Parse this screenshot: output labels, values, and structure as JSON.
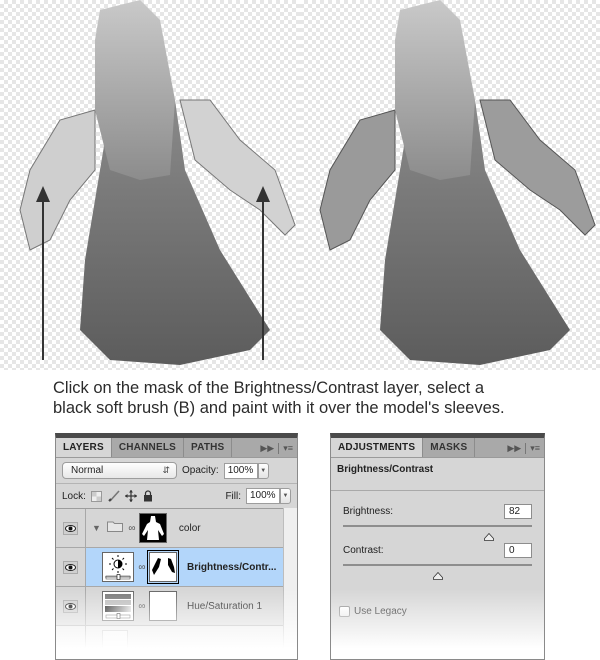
{
  "images": {
    "before": {
      "label": "model-before",
      "arrows": 2
    },
    "after": {
      "label": "model-after"
    }
  },
  "caption": {
    "line1": "Click on the mask of the Brightness/Contrast layer, select a",
    "line2": "black soft brush (B) and paint with it over the model's sleeves."
  },
  "layers_panel": {
    "tabs": [
      "LAYERS",
      "CHANNELS",
      "PATHS"
    ],
    "active_tab": "LAYERS",
    "blend_mode": "Normal",
    "opacity_label": "Opacity:",
    "opacity_value": "100%",
    "lock_label": "Lock:",
    "fill_label": "Fill:",
    "fill_value": "100%",
    "layers": [
      {
        "name": "color",
        "type": "group",
        "expanded": true,
        "visible": true,
        "selected": false
      },
      {
        "name": "Brightness/Contr...",
        "type": "adjustment-brightness-contrast",
        "visible": true,
        "selected": true
      },
      {
        "name": "Hue/Saturation 1",
        "type": "adjustment-hue-saturation",
        "visible": true,
        "selected": false
      }
    ]
  },
  "adjustments_panel": {
    "tabs": [
      "ADJUSTMENTS",
      "MASKS"
    ],
    "active_tab": "ADJUSTMENTS",
    "title": "Brightness/Contrast",
    "brightness_label": "Brightness:",
    "brightness_value": "82",
    "brightness_slider_fraction": 0.77,
    "contrast_label": "Contrast:",
    "contrast_value": "0",
    "contrast_slider_fraction": 0.5,
    "use_legacy_label": "Use Legacy",
    "use_legacy_checked": false
  },
  "icons": {
    "panel_expand": "double-arrow-icon",
    "panel_menu": "panel-menu-icon",
    "eye": "eye-icon",
    "folder": "folder-icon",
    "chain": "link-icon"
  }
}
